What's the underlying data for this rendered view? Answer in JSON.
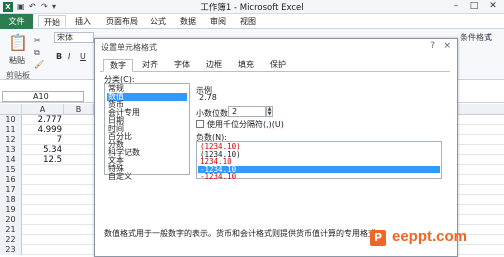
{
  "window": {
    "title": "工作簿1 - Microsoft Excel"
  },
  "ribbon_tabs": [
    "开始",
    "插入",
    "页面布局",
    "公式",
    "数据",
    "审阅",
    "视图"
  ],
  "file_tab": "文件",
  "ribbon": {
    "font_name": "宋体",
    "paste_label": "粘贴",
    "clipboard_label": "剪贴板",
    "bold": "B",
    "italic": "I",
    "underline": "U",
    "cond_format": "条件格式"
  },
  "namebox": "A10",
  "columns": [
    "A",
    "B"
  ],
  "rows": [
    {
      "num": "10",
      "value": "2.777"
    },
    {
      "num": "11",
      "value": "4.999"
    },
    {
      "num": "12",
      "value": "7"
    },
    {
      "num": "13",
      "value": "5.34"
    },
    {
      "num": "14",
      "value": "12.5"
    },
    {
      "num": "15",
      "value": ""
    },
    {
      "num": "16",
      "value": ""
    },
    {
      "num": "17",
      "value": ""
    },
    {
      "num": "18",
      "value": ""
    },
    {
      "num": "19",
      "value": ""
    },
    {
      "num": "20",
      "value": ""
    },
    {
      "num": "21",
      "value": ""
    },
    {
      "num": "22",
      "value": ""
    },
    {
      "num": "23",
      "value": ""
    }
  ],
  "dialog": {
    "title": "设置单元格格式",
    "help": "?",
    "close": "×",
    "tabs": [
      "数字",
      "对齐",
      "字体",
      "边框",
      "填充",
      "保护"
    ],
    "category_label": "分类(C):",
    "categories": [
      "常规",
      "数值",
      "货币",
      "会计专用",
      "日期",
      "时间",
      "百分比",
      "分数",
      "科学记数",
      "文本",
      "特殊",
      "自定义"
    ],
    "selected_category": "数值",
    "sample_label": "示例",
    "sample_value": "2.78",
    "decimal_label": "小数位数(D):",
    "decimal_value": "2",
    "thousands_label": "使用千位分隔符(,)(U)",
    "negative_label": "负数(N):",
    "negative_options": [
      {
        "text": "(1234.10)",
        "style": "red"
      },
      {
        "text": "(1234.10)",
        "style": "normal"
      },
      {
        "text": "1234.10",
        "style": "red"
      },
      {
        "text": "-1234.10",
        "style": "selected"
      },
      {
        "text": "-1234.10",
        "style": "red"
      }
    ],
    "description": "数值格式用于一般数字的表示。货币和会计格式则提供货币值计算的专用格式。"
  },
  "watermark": "eeppt.com",
  "colors": {
    "file_tab": "#2b7d4e",
    "selection": "#3399ff",
    "negative_red": "#d40000",
    "watermark": "#f26522"
  }
}
